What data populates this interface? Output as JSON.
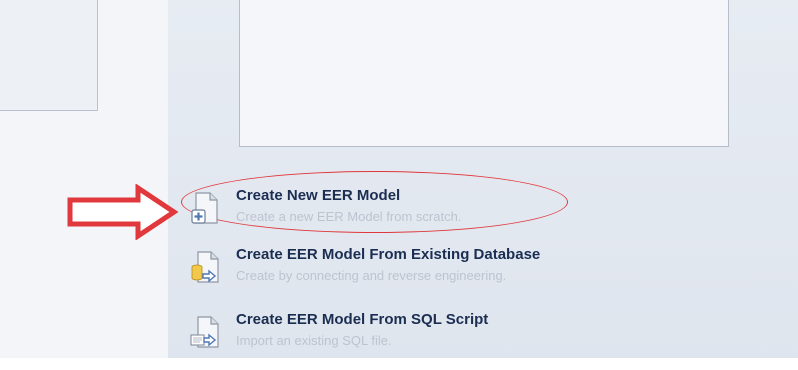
{
  "actions": [
    {
      "title": "Create New EER Model",
      "description": "Create a new EER Model from scratch.",
      "icon": "new-model-icon"
    },
    {
      "title": "Create EER Model From Existing Database",
      "description": "Create by connecting and reverse engineering.",
      "icon": "database-import-icon"
    },
    {
      "title": "Create EER Model From SQL Script",
      "description": "Import an existing SQL file.",
      "icon": "sql-script-import-icon"
    }
  ],
  "annotation": {
    "arrow_color": "#e0383c",
    "highlight_color": "#e0383c"
  }
}
